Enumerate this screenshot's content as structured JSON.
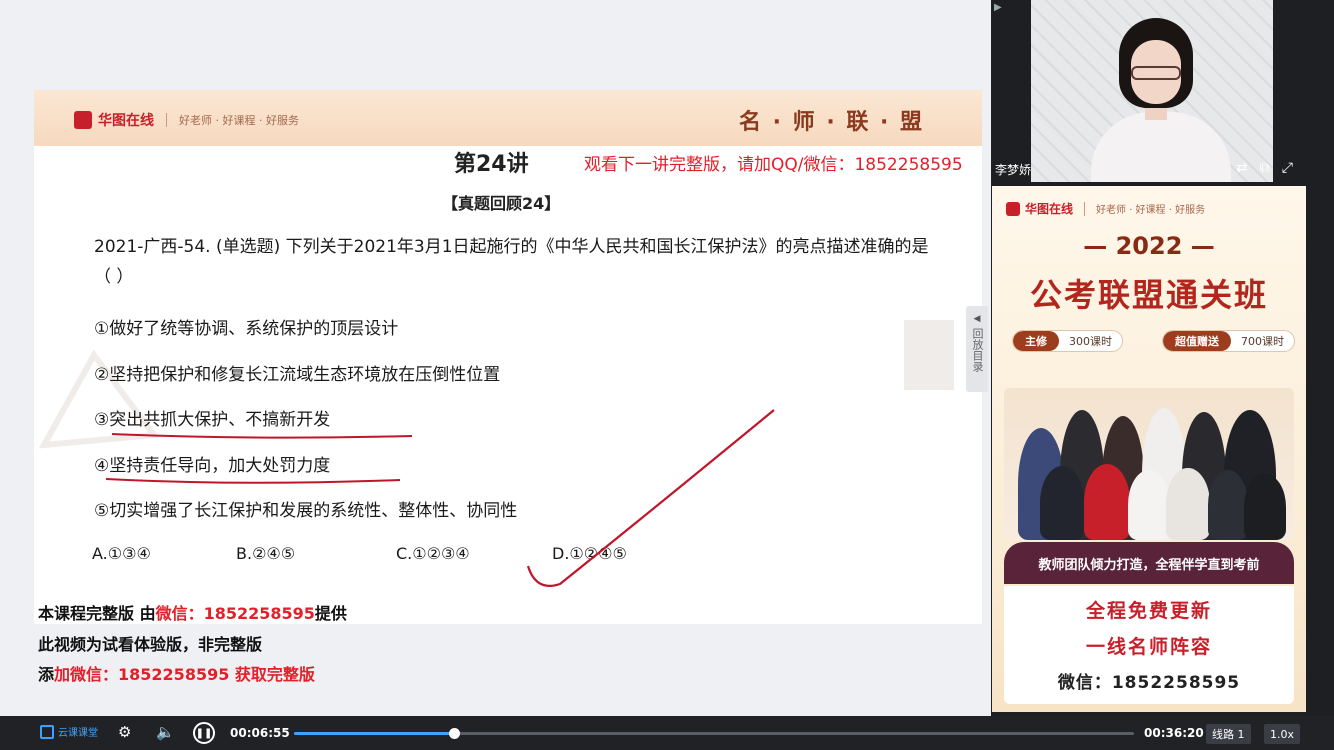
{
  "slide": {
    "brand_name": "华图在线",
    "brand_slogan": "好老师 · 好课程 · 好服务",
    "alliance": "名 · 师 · 联 · 盟",
    "lecture_title": "第24讲",
    "promo_top": "观看下一讲完整版，请加QQ/微信：1852258595",
    "section_title": "【真题回顾24】",
    "question": "2021-广西-54. (单选题) 下列关于2021年3月1日起施行的《中华人民共和国长江保护法》的亮点描述准确的是（  ）",
    "options": [
      "①做好了统等协调、系统保护的顶层设计",
      "②坚持把保护和修复长江流域生态环境放在压倒性位置",
      "③突出共抓大保护、不搞新开发",
      "④坚持责任导向，加大处罚力度",
      "⑤切实增强了长江保护和发展的系统性、整体性、协同性"
    ],
    "choices": [
      "A.①③④",
      "B.②④⑤",
      "C.①②③④",
      "D.①②④⑤"
    ]
  },
  "overlay": {
    "line1_a": "本课程完整版 由",
    "line1_b": "微信：1852258595",
    "line1_c": "提供",
    "line2": "此视频为试看体验版，非完整版",
    "line3_a": "添",
    "line3_b": "加微信：1852258595 获取完整版"
  },
  "side_tab": "回放目录",
  "video": {
    "teacher_name": "李梦娇"
  },
  "ad": {
    "brand_name": "华图在线",
    "brand_slogan": "好老师 · 好课程 · 好服务",
    "year": "— 2022 —",
    "title": "公考联盟通关班",
    "pill1_k": "主修",
    "pill1_v": "300课时",
    "pill2_k": "超值赠送",
    "pill2_v": "700课时",
    "banner": "教师团队倾力打造，全程伴学直到考前",
    "line_a": "全程免费更新",
    "line_b": "一线名师阵容",
    "line_c": "微信：1852258595"
  },
  "player": {
    "logo": "云课课堂",
    "current_time": "00:06:55",
    "total_time": "00:36:20",
    "progress": 0.19,
    "line_label": "线路 1",
    "speed": "1.0x"
  },
  "colors": {
    "accent_red": "#e3202a",
    "annot_red": "#c0152b",
    "progress_blue": "#3fa1ff"
  }
}
